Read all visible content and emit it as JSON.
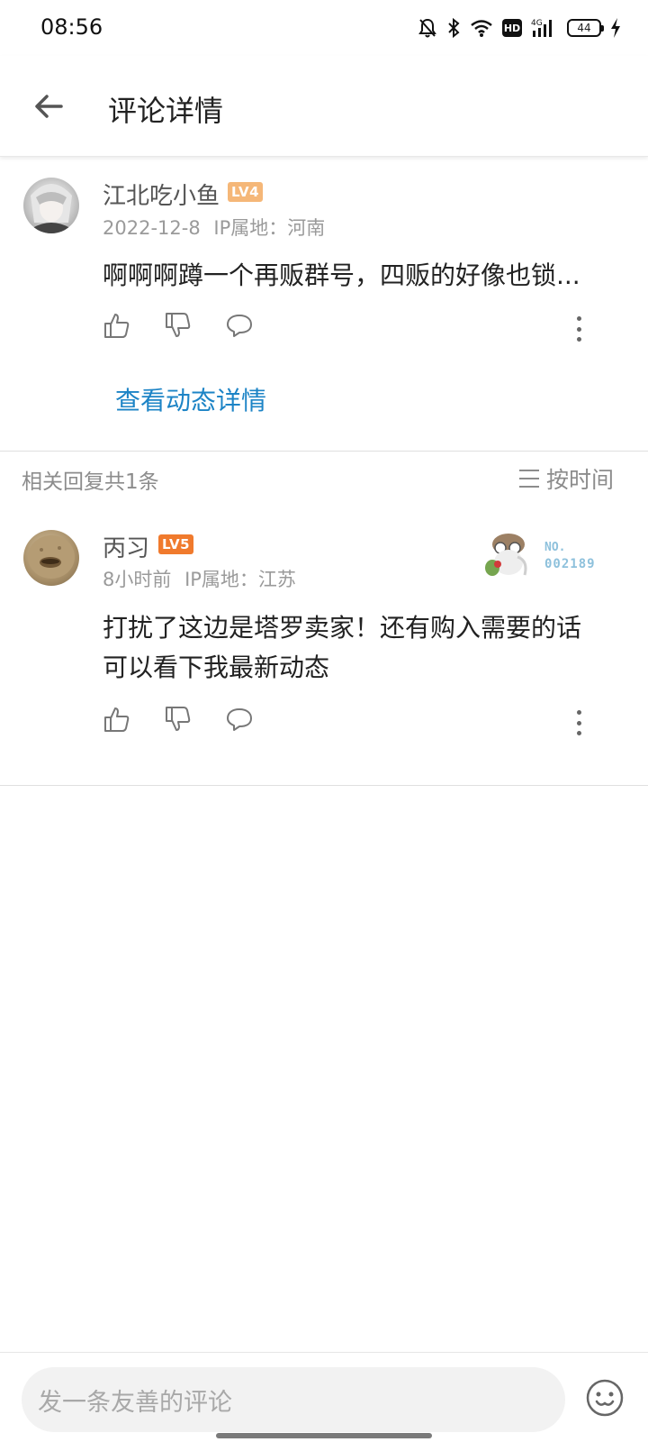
{
  "status_bar": {
    "time": "08:56",
    "network": "4G",
    "hd": "HD",
    "battery": "44"
  },
  "header": {
    "title": "评论详情"
  },
  "main_comment": {
    "username": "江北吃小鱼",
    "level": "LV4",
    "date": "2022-12-8",
    "ip_location": "IP属地：河南",
    "text": "啊啊啊蹲一个再贩群号，四贩的好像也锁...",
    "view_details": "查看动态详情"
  },
  "replies": {
    "count_label": "相关回复共1条",
    "sort_label": "按时间",
    "items": [
      {
        "username": "丙习",
        "level": "LV5",
        "time": "8小时前",
        "ip_location": "IP属地：江苏",
        "fan_badge_label": "NO.",
        "fan_badge_number": "002189",
        "text_line1": "打扰了这边是塔罗卖家！还有购入需要的话",
        "text_line2": "可以看下我最新动态"
      }
    ]
  },
  "bottom_bar": {
    "input_placeholder": "发一条友善的评论"
  },
  "icons": {
    "back": "arrow-left-icon",
    "like": "thumb-up-icon",
    "dislike": "thumb-down-icon",
    "reply": "chat-bubble-icon",
    "more": "more-vertical-icon",
    "sort": "menu-lines-icon",
    "emoji": "emoji-icon"
  }
}
